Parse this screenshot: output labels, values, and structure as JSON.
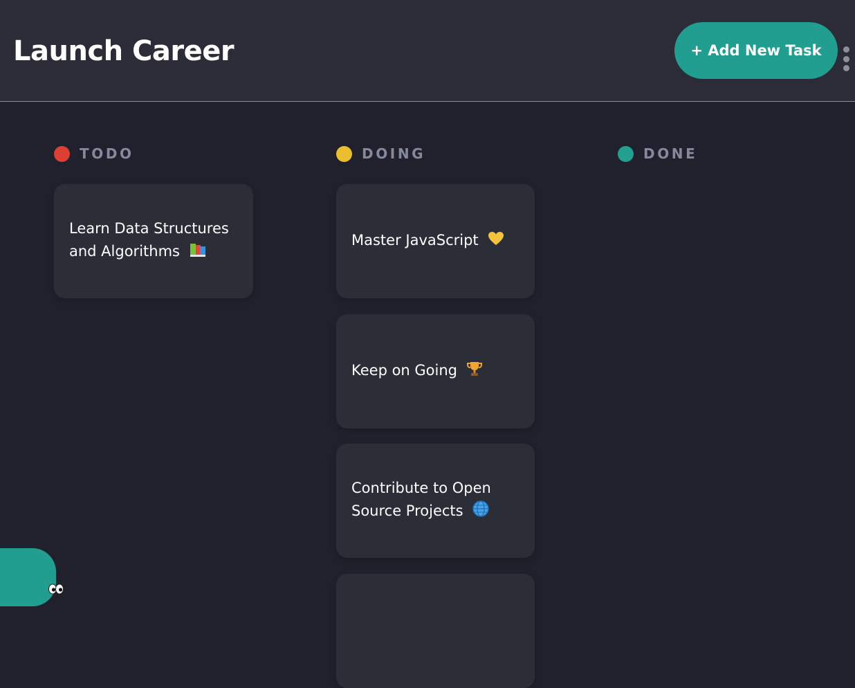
{
  "header": {
    "board_title": "Launch Career",
    "add_task_label": "+ Add New Task",
    "menu_icon": "kebab-menu-icon"
  },
  "columns": [
    {
      "name": "TODO",
      "status_color": "#dc3f34",
      "cards": [
        {
          "title": "Learn Data Structures and Algorithms",
          "emoji": "books-icon"
        }
      ]
    },
    {
      "name": "DOING",
      "status_color": "#ebbe30",
      "cards": [
        {
          "title": "Master JavaScript",
          "emoji": "yellow-heart-icon"
        },
        {
          "title": "Keep on Going",
          "emoji": "trophy-icon"
        },
        {
          "title": "Contribute to Open Source Projects",
          "emoji": "globe-icon"
        },
        {
          "title": "",
          "emoji": ""
        }
      ]
    },
    {
      "name": "DONE",
      "status_color": "#21a090",
      "cards": []
    }
  ],
  "colors": {
    "accent": "#219e90",
    "background": "#21212d",
    "surface": "#2b2c37",
    "muted_text": "#848a9c"
  },
  "floating_button": {
    "icon": "eyes-icon"
  }
}
